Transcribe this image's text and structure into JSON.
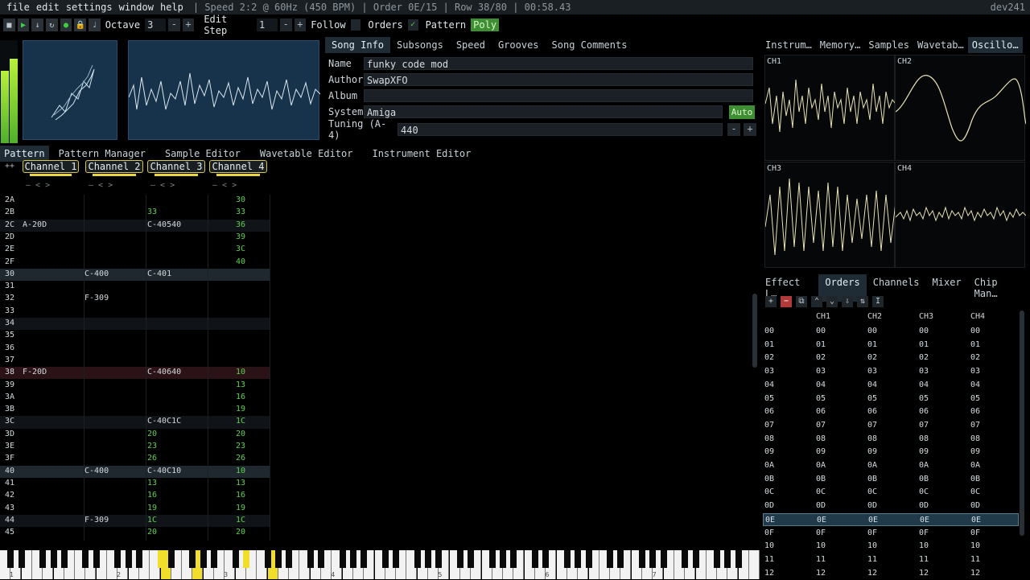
{
  "menubar": {
    "items": [
      "file",
      "edit",
      "settings",
      "window",
      "help"
    ],
    "status": "| Speed 2:2 @ 60Hz (450 BPM) | Order 0E/15 | Row 38/80 | 00:58.43",
    "version": "dev241"
  },
  "toolbar": {
    "octave_label": "Octave",
    "octave_value": "3",
    "edit_step_label": "Edit Step",
    "edit_step_value": "1",
    "follow_label": "Follow",
    "orders_label": "Orders",
    "pattern_label": "Pattern",
    "poly_label": "Poly"
  },
  "song_tabs": [
    "Song Info",
    "Subsongs",
    "Speed",
    "Grooves",
    "Song Comments"
  ],
  "song_info": {
    "name_label": "Name",
    "name": "funky code mod",
    "author_label": "Author",
    "author": "SwapXFO",
    "album_label": "Album",
    "album": "",
    "system_label": "System",
    "system": "Amiga",
    "auto_label": "Auto",
    "tuning_label": "Tuning (A-4)",
    "tuning": "440"
  },
  "right_tabs": [
    "Instrum…",
    "Memory…",
    "Samples",
    "Wavetab…",
    "Oscillo…"
  ],
  "main_tabs": [
    "Pattern",
    "Pattern Manager",
    "Sample Editor",
    "Wavetable Editor",
    "Instrument Editor"
  ],
  "channels": [
    "Channel 1",
    "Channel 2",
    "Channel 3",
    "Channel 4"
  ],
  "pattern_rows": [
    {
      "n": "2A",
      "c1": "",
      "c2": "",
      "c3": "",
      "c4": "30",
      "style": ""
    },
    {
      "n": "2B",
      "c1": "",
      "c2": "",
      "c3": "33",
      "c4": "33",
      "style": ""
    },
    {
      "n": "2C",
      "c1": "A-20D",
      "c2": "",
      "c3": "C-40540",
      "c4": "36",
      "style": "alt"
    },
    {
      "n": "2D",
      "c1": "",
      "c2": "",
      "c3": "",
      "c4": "39",
      "style": ""
    },
    {
      "n": "2E",
      "c1": "",
      "c2": "",
      "c3": "",
      "c4": "3C",
      "style": ""
    },
    {
      "n": "2F",
      "c1": "",
      "c2": "",
      "c3": "",
      "c4": "40",
      "style": ""
    },
    {
      "n": "30",
      "c1": "",
      "c2": "C-400",
      "c3": "C-401",
      "c4": "",
      "style": "bar30"
    },
    {
      "n": "31",
      "c1": "",
      "c2": "",
      "c3": "",
      "c4": "",
      "style": ""
    },
    {
      "n": "32",
      "c1": "",
      "c2": "F-309",
      "c3": "",
      "c4": "",
      "style": ""
    },
    {
      "n": "33",
      "c1": "",
      "c2": "",
      "c3": "",
      "c4": "",
      "style": ""
    },
    {
      "n": "34",
      "c1": "",
      "c2": "",
      "c3": "",
      "c4": "",
      "style": "alt"
    },
    {
      "n": "35",
      "c1": "",
      "c2": "",
      "c3": "",
      "c4": "",
      "style": ""
    },
    {
      "n": "36",
      "c1": "",
      "c2": "",
      "c3": "",
      "c4": "",
      "style": ""
    },
    {
      "n": "37",
      "c1": "",
      "c2": "",
      "c3": "",
      "c4": "",
      "style": ""
    },
    {
      "n": "38",
      "c1": "F-20D",
      "c2": "",
      "c3": "C-40640",
      "c4": "10",
      "style": "cur"
    },
    {
      "n": "39",
      "c1": "",
      "c2": "",
      "c3": "",
      "c4": "13",
      "style": ""
    },
    {
      "n": "3A",
      "c1": "",
      "c2": "",
      "c3": "",
      "c4": "16",
      "style": ""
    },
    {
      "n": "3B",
      "c1": "",
      "c2": "",
      "c3": "",
      "c4": "19",
      "style": ""
    },
    {
      "n": "3C",
      "c1": "",
      "c2": "",
      "c3": "C-40C1C",
      "c4": "1C",
      "style": "alt"
    },
    {
      "n": "3D",
      "c1": "",
      "c2": "",
      "c3": "20",
      "c4": "20",
      "style": ""
    },
    {
      "n": "3E",
      "c1": "",
      "c2": "",
      "c3": "23",
      "c4": "23",
      "style": ""
    },
    {
      "n": "3F",
      "c1": "",
      "c2": "",
      "c3": "26",
      "c4": "26",
      "style": ""
    },
    {
      "n": "40",
      "c1": "",
      "c2": "C-400",
      "c3": "C-40C10",
      "c4": "10",
      "style": "bar30"
    },
    {
      "n": "41",
      "c1": "",
      "c2": "",
      "c3": "13",
      "c4": "13",
      "style": ""
    },
    {
      "n": "42",
      "c1": "",
      "c2": "",
      "c3": "16",
      "c4": "16",
      "style": ""
    },
    {
      "n": "43",
      "c1": "",
      "c2": "",
      "c3": "19",
      "c4": "19",
      "style": ""
    },
    {
      "n": "44",
      "c1": "",
      "c2": "F-309",
      "c3": "1C",
      "c4": "1C",
      "style": "alt"
    },
    {
      "n": "45",
      "c1": "",
      "c2": "",
      "c3": "20",
      "c4": "20",
      "style": ""
    }
  ],
  "osc_labels": [
    "CH1",
    "CH2",
    "CH3",
    "CH4"
  ],
  "lower_tabs": [
    "Effect L…",
    "Orders",
    "Channels",
    "Mixer",
    "Chip Man…"
  ],
  "orders_header": [
    "CH1",
    "CH2",
    "CH3",
    "CH4"
  ],
  "orders_rows": [
    "00",
    "01",
    "02",
    "03",
    "04",
    "05",
    "06",
    "07",
    "08",
    "09",
    "0A",
    "0B",
    "0C",
    "0D",
    "0E",
    "0F",
    "10",
    "11",
    "12"
  ],
  "orders_current": "0E",
  "piano_octave_labels": [
    "1",
    "2",
    "3",
    "4",
    "5",
    "6",
    "7"
  ]
}
